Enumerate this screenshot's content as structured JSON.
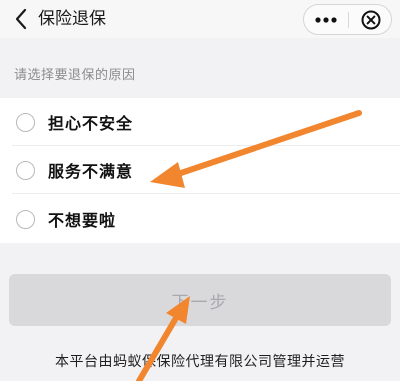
{
  "navbar": {
    "title": "保险退保",
    "back_icon": "chevron-left-icon",
    "more_icon": "more-dots-icon",
    "close_icon": "close-circle-icon"
  },
  "reason_section": {
    "label": "请选择要退保的原因",
    "options": [
      {
        "label": "担心不安全",
        "selected": false
      },
      {
        "label": "服务不满意",
        "selected": false
      },
      {
        "label": "不想要啦",
        "selected": false
      }
    ]
  },
  "next_button": {
    "label": "下一步",
    "enabled": false
  },
  "footer": {
    "text": "本平台由蚂蚁保保险代理有限公司管理并运营"
  },
  "colors": {
    "annotation_arrow": "#f2862e",
    "button_disabled_bg": "#d9d9dc",
    "button_disabled_text": "#a9a9ad"
  }
}
